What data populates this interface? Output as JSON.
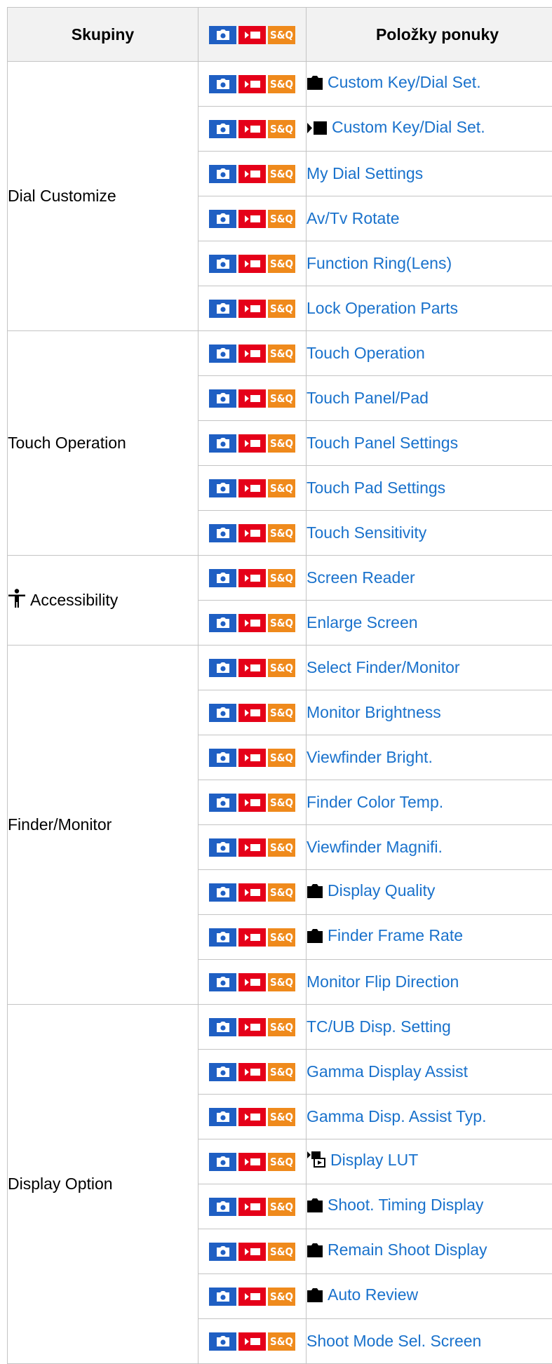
{
  "header": {
    "col_groups": "Skupiny",
    "col_items": "Položky ponuky",
    "sq_label": "S&Q"
  },
  "colors": {
    "photo": "#1f5fc3",
    "movie": "#e50019",
    "sq": "#ef8a1c",
    "link": "#1a72cc"
  },
  "groups": [
    {
      "label": "Dial Customize",
      "icon": "",
      "items": [
        {
          "label": "Custom Key/Dial Set.",
          "prefix": "camera-icon"
        },
        {
          "label": "Custom Key/Dial Set.",
          "prefix": "movie-camera-icon"
        },
        {
          "label": "My Dial Settings",
          "prefix": ""
        },
        {
          "label": "Av/Tv Rotate",
          "prefix": ""
        },
        {
          "label": "Function Ring(Lens)",
          "prefix": ""
        },
        {
          "label": "Lock Operation Parts",
          "prefix": ""
        }
      ]
    },
    {
      "label": "Touch Operation",
      "icon": "",
      "items": [
        {
          "label": "Touch Operation",
          "prefix": ""
        },
        {
          "label": "Touch Panel/Pad",
          "prefix": ""
        },
        {
          "label": "Touch Panel Settings",
          "prefix": ""
        },
        {
          "label": "Touch Pad Settings",
          "prefix": ""
        },
        {
          "label": "Touch Sensitivity",
          "prefix": ""
        }
      ]
    },
    {
      "label": "Accessibility",
      "icon": "accessibility-icon",
      "items": [
        {
          "label": "Screen Reader",
          "prefix": ""
        },
        {
          "label": "Enlarge Screen",
          "prefix": ""
        }
      ]
    },
    {
      "label": "Finder/Monitor",
      "icon": "",
      "items": [
        {
          "label": "Select Finder/Monitor",
          "prefix": ""
        },
        {
          "label": "Monitor Brightness",
          "prefix": ""
        },
        {
          "label": "Viewfinder Bright.",
          "prefix": ""
        },
        {
          "label": "Finder Color Temp.",
          "prefix": ""
        },
        {
          "label": "Viewfinder Magnifi.",
          "prefix": ""
        },
        {
          "label": "Display Quality",
          "prefix": "camera-icon"
        },
        {
          "label": "Finder Frame Rate",
          "prefix": "camera-icon"
        },
        {
          "label": "Monitor Flip Direction",
          "prefix": ""
        }
      ]
    },
    {
      "label": "Display Option",
      "icon": "",
      "items": [
        {
          "label": "TC/UB Disp. Setting",
          "prefix": ""
        },
        {
          "label": "Gamma Display Assist",
          "prefix": ""
        },
        {
          "label": "Gamma Disp. Assist Typ.",
          "prefix": ""
        },
        {
          "label": "Display LUT",
          "prefix": "movie-playback-icon"
        },
        {
          "label": "Shoot. Timing Display",
          "prefix": "camera-icon"
        },
        {
          "label": "Remain Shoot Display",
          "prefix": "camera-icon"
        },
        {
          "label": "Auto Review",
          "prefix": "camera-icon"
        },
        {
          "label": "Shoot Mode Sel. Screen",
          "prefix": ""
        }
      ]
    }
  ]
}
